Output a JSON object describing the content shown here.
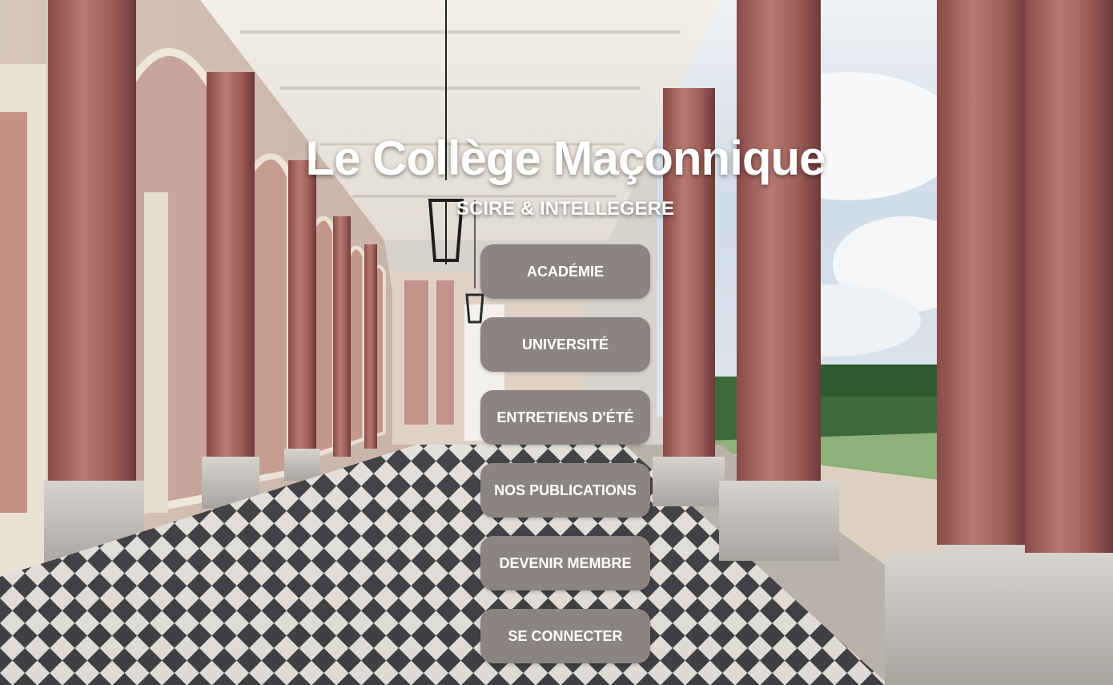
{
  "header": {
    "title": "Le Collège Maçonnique",
    "subtitle": "SCIRE & INTELLEGERE"
  },
  "menu": {
    "items": [
      {
        "label": "ACADÉMIE"
      },
      {
        "label": "UNIVERSITÉ"
      },
      {
        "label": "ENTRETIENS D'ÉTÉ"
      },
      {
        "label": "NOS PUBLICATIONS"
      },
      {
        "label": "DEVENIR MEMBRE"
      },
      {
        "label": "SE CONNECTER"
      }
    ]
  },
  "colors": {
    "button_bg": "#8c8480",
    "button_text": "#ffffff",
    "title_text": "#ffffff"
  }
}
